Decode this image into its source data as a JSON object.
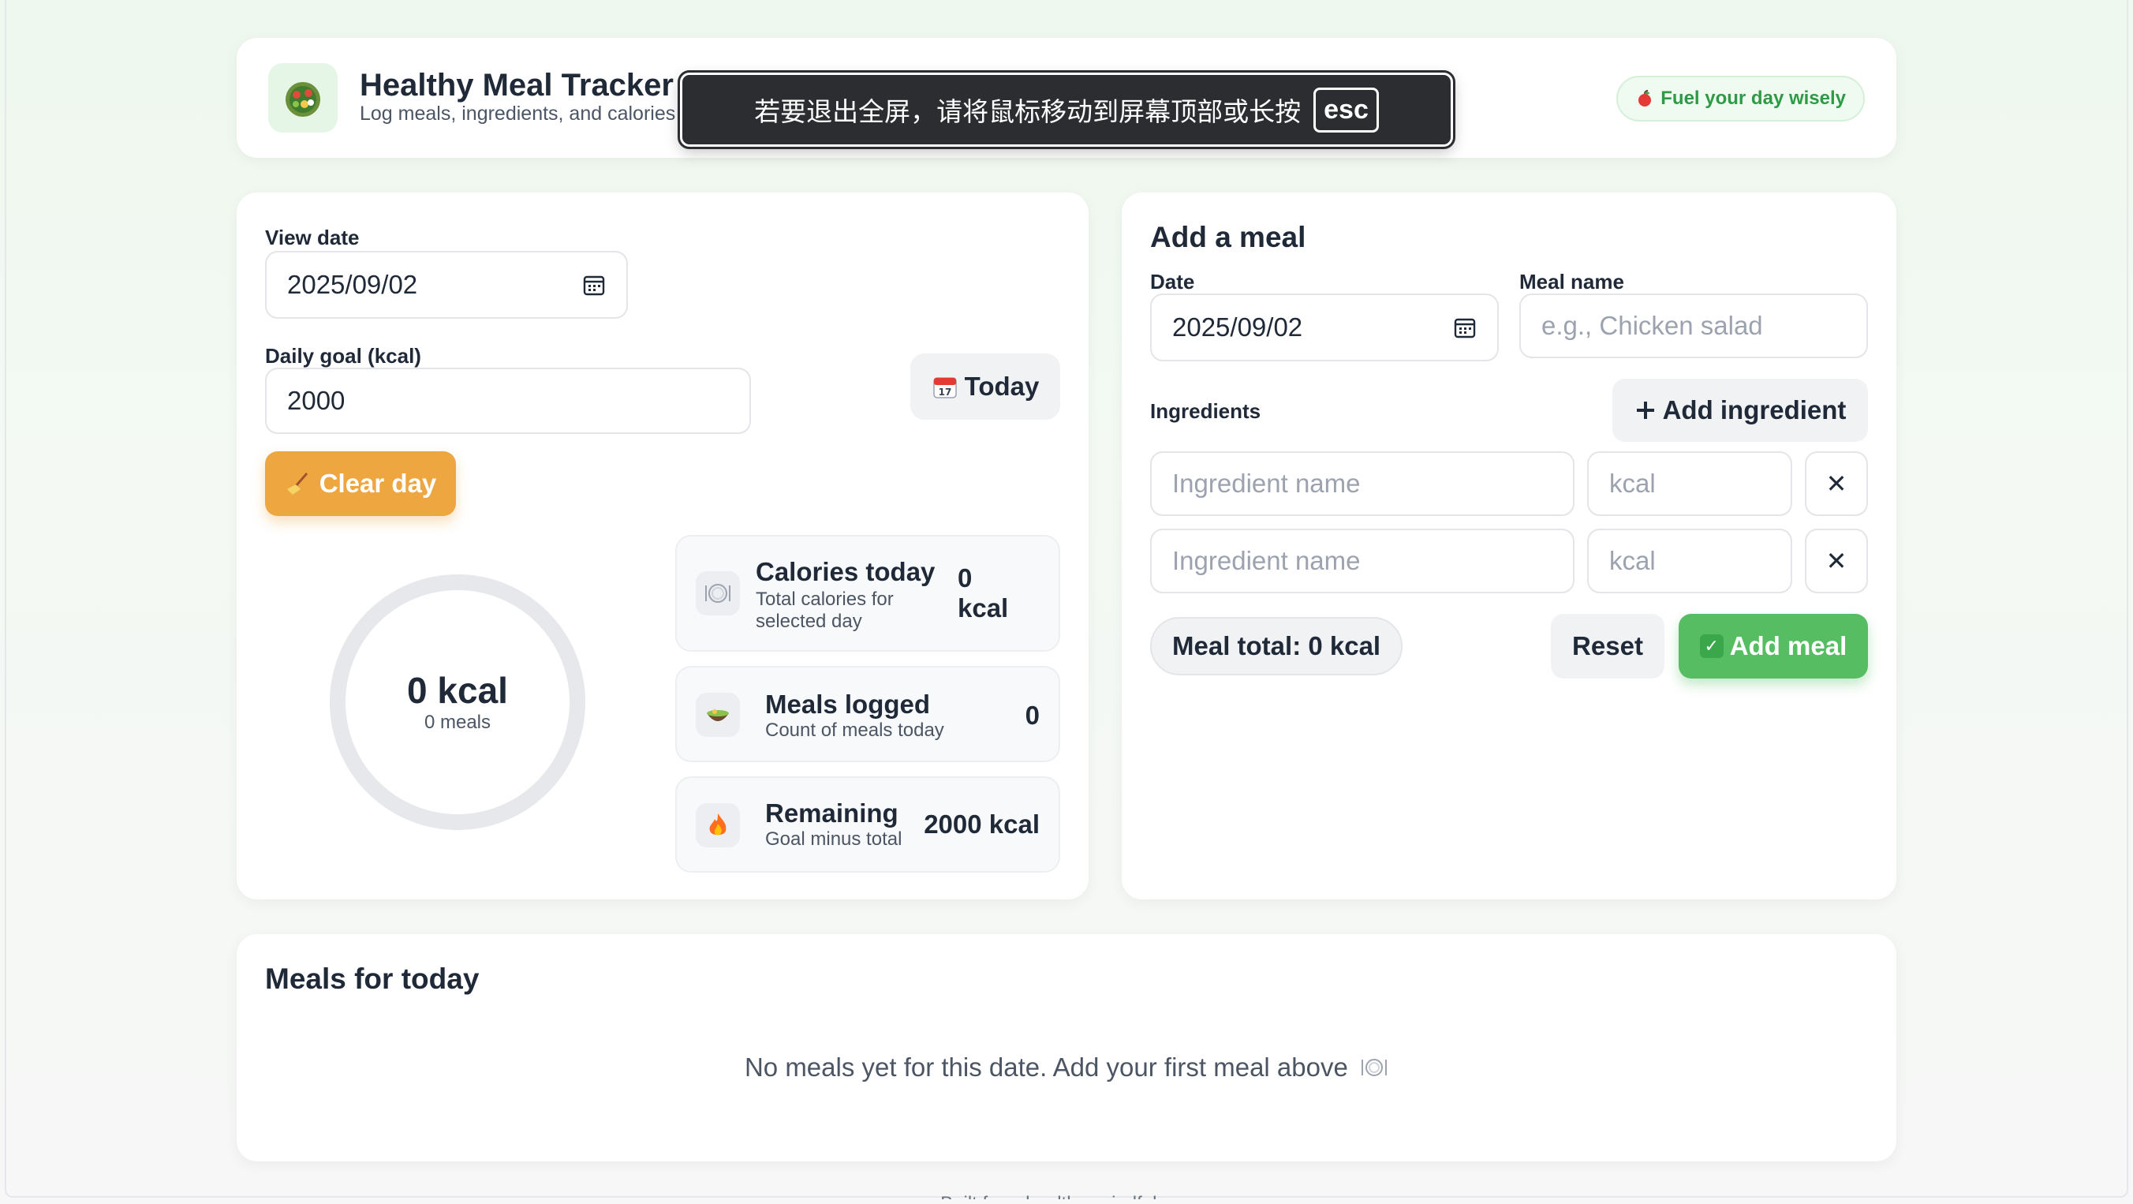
{
  "header": {
    "title": "Healthy Meal Tracker",
    "subtitle": "Log meals, ingredients, and calories",
    "tagline": "Fuel your day wisely",
    "tagline_icon": "apple-icon"
  },
  "overlay": {
    "message": "若要退出全屏，请将鼠标移动到屏幕顶部或长按",
    "key": "esc"
  },
  "left": {
    "view_date_label": "View date",
    "view_date_value": "2025/09/02",
    "goal_label": "Daily goal (kcal)",
    "goal_value": "2000",
    "today_button": "Today",
    "clear_button": "Clear day",
    "ring": {
      "value": "0 kcal",
      "sub": "0 meals",
      "progress": 0
    },
    "stats": [
      {
        "title": "Calories today",
        "subtitle": "Total calories for selected day",
        "value": "0 kcal",
        "icon": "plate-icon"
      },
      {
        "title": "Meals logged",
        "subtitle": "Count of meals today",
        "value": "0",
        "icon": "bowl-icon"
      },
      {
        "title": "Remaining",
        "subtitle": "Goal minus total",
        "value": "2000 kcal",
        "icon": "fire-icon"
      }
    ]
  },
  "add_meal": {
    "title": "Add a meal",
    "date_label": "Date",
    "date_value": "2025/09/02",
    "name_label": "Meal name",
    "name_placeholder": "e.g., Chicken salad",
    "ingredients_label": "Ingredients",
    "add_ingredient_button": "Add ingredient",
    "ingredients": [
      {
        "name_placeholder": "Ingredient name",
        "kcal_placeholder": "kcal",
        "remove": "✕"
      },
      {
        "name_placeholder": "Ingredient name",
        "kcal_placeholder": "kcal",
        "remove": "✕"
      }
    ],
    "meal_total": "Meal total: 0 kcal",
    "reset_button": "Reset",
    "add_meal_button": "Add meal"
  },
  "meals": {
    "title": "Meals for today",
    "empty_message": "No meals yet for this date. Add your first meal above"
  },
  "footer": {
    "text": "Built for a healthy, mindful you"
  },
  "colors": {
    "accent_green": "#57bd62",
    "accent_orange": "#eea641",
    "tag_green": "#2e9a45"
  }
}
